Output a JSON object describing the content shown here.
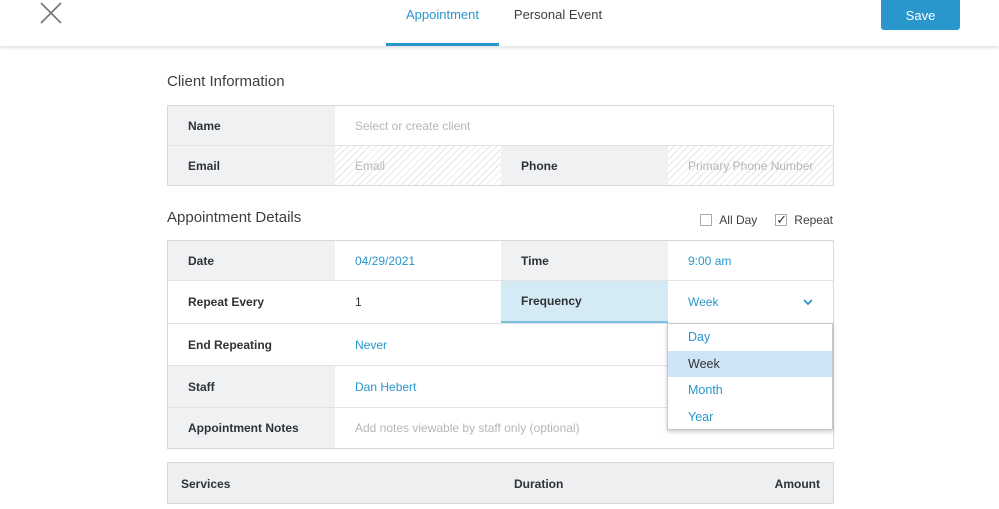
{
  "header": {
    "tabs": [
      {
        "label": "Appointment",
        "active": true
      },
      {
        "label": "Personal Event",
        "active": false
      }
    ],
    "save_label": "Save",
    "close_icon": "close-x-icon"
  },
  "client_information": {
    "title": "Client Information",
    "name_label": "Name",
    "name_placeholder": "Select or create client",
    "email_label": "Email",
    "email_placeholder": "Email",
    "phone_label": "Phone",
    "phone_placeholder": "Primary Phone Number"
  },
  "appointment_details": {
    "title": "Appointment Details",
    "all_day_label": "All Day",
    "all_day_checked": false,
    "repeat_label": "Repeat",
    "repeat_checked": true,
    "date_label": "Date",
    "date_value": "04/29/2021",
    "time_label": "Time",
    "time_value": "9:00 am",
    "repeat_every_label": "Repeat Every",
    "repeat_every_value": "1",
    "frequency_label": "Frequency",
    "frequency_value": "Week",
    "end_repeating_label": "End Repeating",
    "end_repeating_value": "Never",
    "staff_label": "Staff",
    "staff_value": "Dan Hebert",
    "notes_label": "Appointment Notes",
    "notes_placeholder": "Add notes viewable by staff only (optional)"
  },
  "frequency_options": [
    {
      "label": "Day"
    },
    {
      "label": "Week",
      "selected": true
    },
    {
      "label": "Month"
    },
    {
      "label": "Year"
    }
  ],
  "services": {
    "services_label": "Services",
    "duration_label": "Duration",
    "amount_label": "Amount"
  },
  "colors": {
    "accent": "#2996cc",
    "frequency_highlight": "#d4eaf5",
    "selected_option": "#cfe4f6"
  }
}
